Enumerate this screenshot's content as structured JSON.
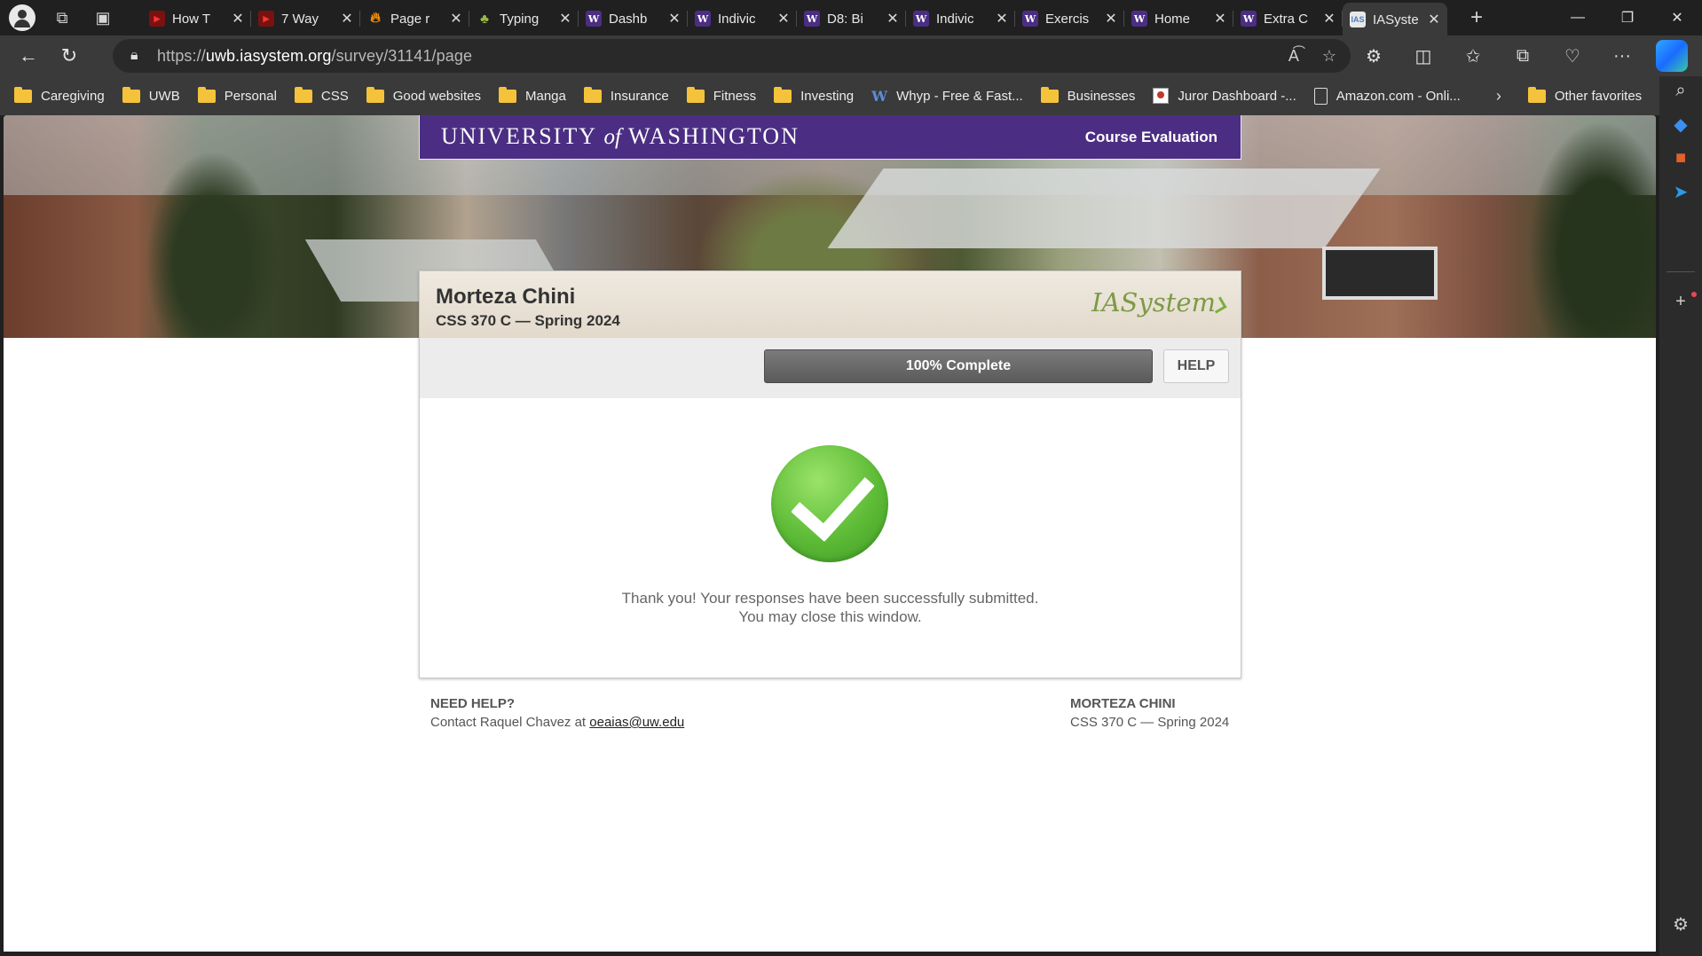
{
  "browser": {
    "tabs": [
      {
        "title": "How T",
        "icon": "youtube-icon"
      },
      {
        "title": "7 Way",
        "icon": "youtube-icon"
      },
      {
        "title": "Page r",
        "icon": "fire-icon"
      },
      {
        "title": "Typing",
        "icon": "typing-icon"
      },
      {
        "title": "Dashb",
        "icon": "uw-icon"
      },
      {
        "title": "Indivic",
        "icon": "uw-icon"
      },
      {
        "title": "D8: Bi",
        "icon": "uw-icon"
      },
      {
        "title": "Indivic",
        "icon": "uw-icon"
      },
      {
        "title": "Exercis",
        "icon": "uw-icon"
      },
      {
        "title": "Home",
        "icon": "uw-icon"
      },
      {
        "title": "Extra C",
        "icon": "uw-icon"
      },
      {
        "title": "IASyste",
        "icon": "iasystem-icon",
        "active": true
      }
    ],
    "url_prefix": "https://",
    "url_host": "uwb.iasystem.org",
    "url_path": "/survey/31141/page",
    "bookmarks": [
      {
        "label": "Caregiving",
        "type": "folder"
      },
      {
        "label": "UWB",
        "type": "folder"
      },
      {
        "label": "Personal",
        "type": "folder"
      },
      {
        "label": "CSS",
        "type": "folder"
      },
      {
        "label": "Good websites",
        "type": "folder"
      },
      {
        "label": "Manga",
        "type": "folder"
      },
      {
        "label": "Insurance",
        "type": "folder"
      },
      {
        "label": "Fitness",
        "type": "folder"
      },
      {
        "label": "Investing",
        "type": "folder"
      },
      {
        "label": "Whyp - Free & Fast...",
        "type": "link"
      },
      {
        "label": "Businesses",
        "type": "folder"
      },
      {
        "label": "Juror Dashboard -...",
        "type": "link"
      },
      {
        "label": "Amazon.com - Onli...",
        "type": "link"
      }
    ],
    "other_favorites": "Other favorites"
  },
  "page": {
    "uw_title_a": "UNIVERSITY",
    "uw_title_of": "of",
    "uw_title_b": "WASHINGTON",
    "course_evaluation": "Course Evaluation",
    "instructor": "Morteza Chini",
    "course": "CSS 370 C — Spring 2024",
    "logo": "IASystem",
    "progress_label": "100% Complete",
    "progress_value": 1.0,
    "help": "HELP",
    "thanks_line1": "Thank you! Your responses have been successfully submitted.",
    "thanks_line2": "You may close this window.",
    "footer": {
      "need_help": "NEED HELP?",
      "contact_prefix": "Contact Raquel Chavez at",
      "email": "oeaias@uw.edu",
      "right_name": "MORTEZA CHINI",
      "right_course": "CSS 370 C — Spring 2024"
    }
  },
  "colors": {
    "uw_purple": "#4b2e83",
    "check_green": "#5dbb36",
    "progress_gray": "#666666"
  }
}
